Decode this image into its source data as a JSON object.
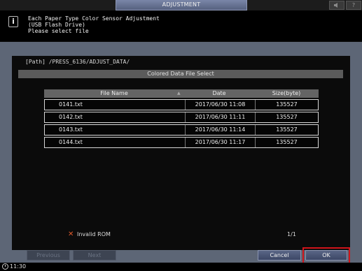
{
  "header": {
    "title": "ADJUSTMENT",
    "right_buttons": [
      "speaker-icon",
      "help-icon"
    ],
    "help_label": "?"
  },
  "message": {
    "icon": "i",
    "line1": "Each Paper Type Color Sensor Adjustment",
    "line2": "(USB Flash Drive)",
    "line3": "Please select file"
  },
  "dialog": {
    "path": "[Path] /PRESS_6136/ADJUST_DATA/",
    "title": "Colored Data File Select",
    "columns": {
      "name": "File Name",
      "date": "Date",
      "size": "Size(byte)"
    },
    "rows": [
      {
        "name": "0141.txt",
        "date": "2017/06/30 11:08",
        "size": "135527"
      },
      {
        "name": "0142.txt",
        "date": "2017/06/30 11:11",
        "size": "135527"
      },
      {
        "name": "0143.txt",
        "date": "2017/06/30 11:14",
        "size": "135527"
      },
      {
        "name": "0144.txt",
        "date": "2017/06/30 11:17",
        "size": "135527"
      }
    ],
    "legend_mark": "✕",
    "legend": "Invalid ROM",
    "page": "1/1"
  },
  "buttons": {
    "previous": "Previous",
    "next": "Next",
    "cancel": "Cancel",
    "ok": "OK"
  },
  "status": {
    "time": "11:30"
  },
  "colors": {
    "highlight": "#d0141a",
    "invalid_mark": "#e25a2a",
    "frame": "#5d6676"
  }
}
